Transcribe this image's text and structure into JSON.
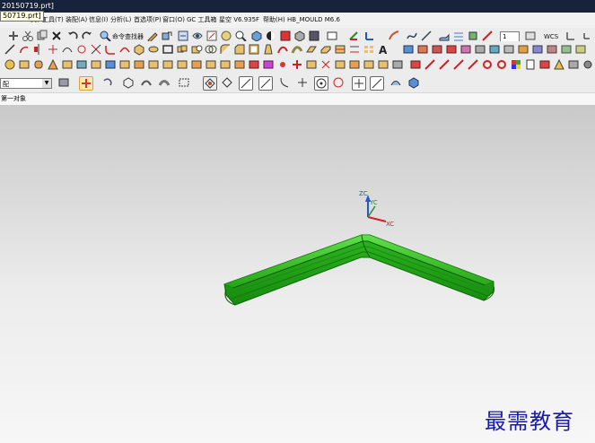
{
  "window": {
    "title": "20150719.prt]",
    "tooltip": "50719.prt]"
  },
  "menu": {
    "items": [
      "具(T)",
      "工具(T)",
      "装配(A)",
      "信息(I)",
      "分析(L)",
      "首选项(P)",
      "窗口(O)",
      "GC 工具箱",
      "星空 V6.935F",
      "帮助(H)",
      "HB_MOULD M6.6"
    ]
  },
  "toolbar": {
    "command_finder": "命令查找器",
    "layer_value": "1",
    "wcs_label": "WCS"
  },
  "selection": {
    "filter": "配"
  },
  "cue_line": {
    "text": "第一对象"
  },
  "csys": {
    "zc": "ZC",
    "yc": "YC",
    "xc": "XC"
  },
  "watermark": {
    "text": "最需教育"
  },
  "colors": {
    "part": "#2fbf1e",
    "titlebar": "#17233a",
    "viewport_top": "#c9c9c9",
    "watermark": "#1a1aa8"
  }
}
